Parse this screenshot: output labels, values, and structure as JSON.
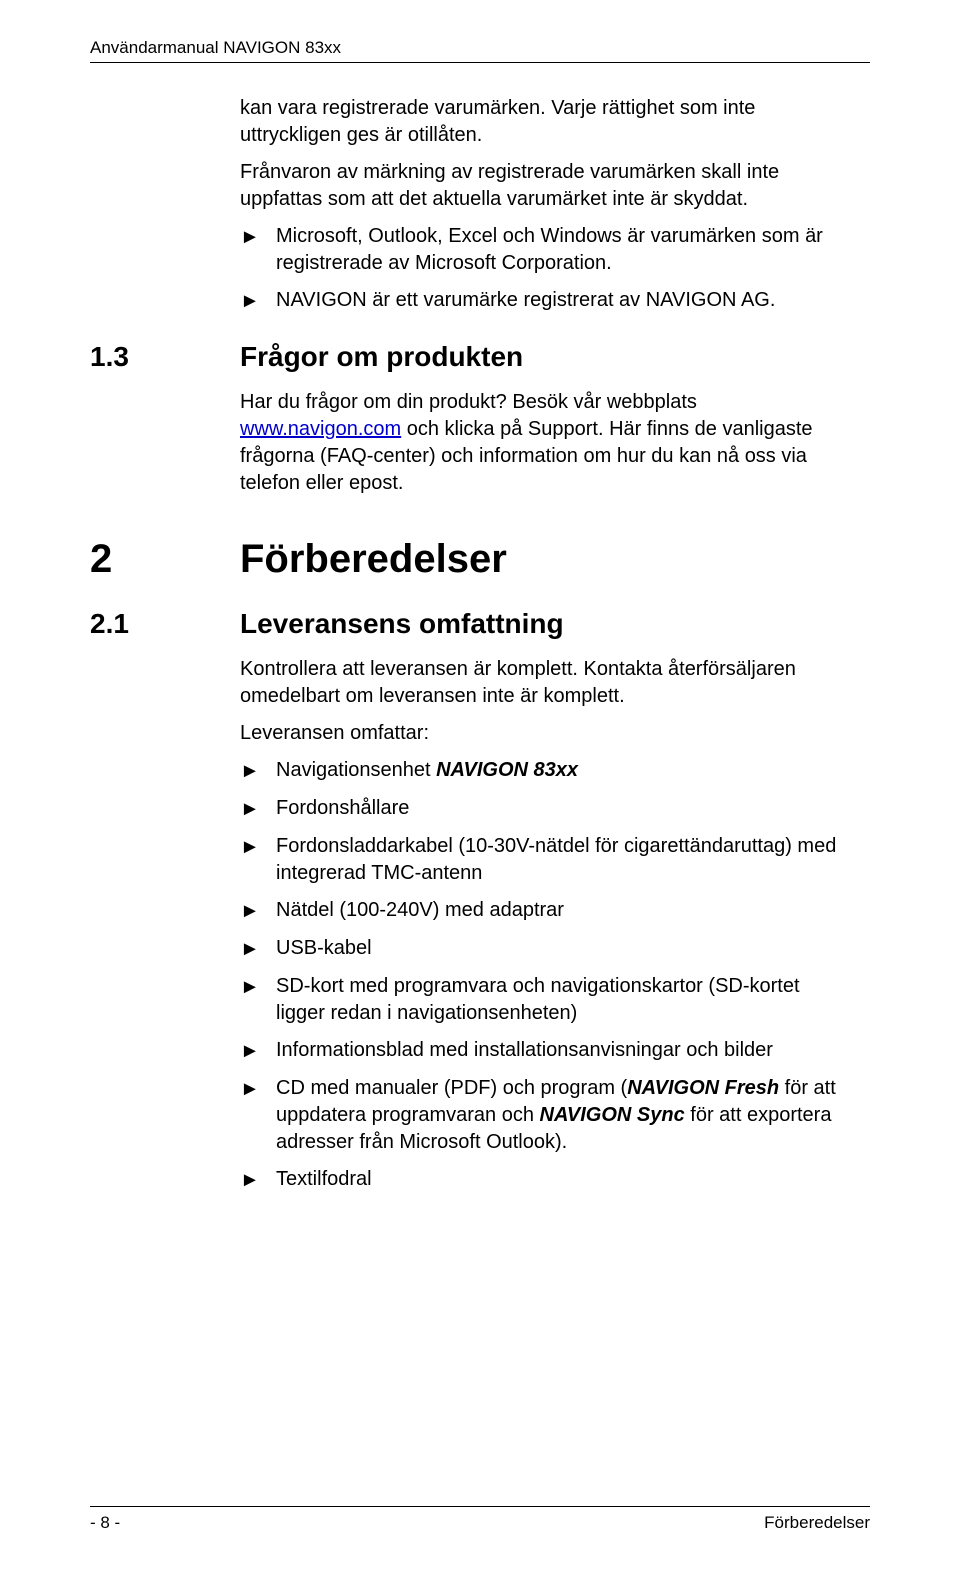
{
  "header": {
    "title": "Användarmanual NAVIGON 83xx"
  },
  "intro": {
    "p1": "kan vara registrerade varumärken. Varje rättighet som inte uttryckligen ges är otillåten.",
    "p2": "Frånvaron av märkning av registrerade varumärken skall inte uppfattas som att det aktuella varumärket inte är skyddat.",
    "bullets": [
      "Microsoft, Outlook, Excel och Windows är varumärken som är registrerade av Microsoft Corporation.",
      "NAVIGON är ett varumärke registrerat av NAVIGON AG."
    ]
  },
  "section13": {
    "num": "1.3",
    "title": "Frågor om produkten",
    "p1a": "Har du frågor om din produkt? Besök vår webbplats ",
    "link": "www.navigon.com",
    "p1b": " och klicka på Support. Här finns de vanligaste frågorna (FAQ-center) och information om hur du kan nå oss via telefon eller epost."
  },
  "chapter2": {
    "num": "2",
    "title": "Förberedelser"
  },
  "section21": {
    "num": "2.1",
    "title": "Leveransens omfattning",
    "p1": "Kontrollera att leveransen är komplett. Kontakta återförsäljaren omedelbart om leveransen inte är komplett.",
    "p2": "Leveransen omfattar:",
    "bullets": {
      "b1a": "Navigationsenhet ",
      "b1b": "NAVIGON 83xx",
      "b2": "Fordonshållare",
      "b3": "Fordonsladdarkabel (10-30V-nätdel för cigarettändaruttag) med integrerad TMC-antenn",
      "b4": "Nätdel (100-240V) med adaptrar",
      "b5": "USB-kabel",
      "b6": "SD-kort med programvara och navigationskartor (SD-kortet ligger redan i navigationsenheten)",
      "b7": "Informationsblad med installationsanvisningar och bilder",
      "b8a": "CD med manualer (PDF) och program (",
      "b8b": "NAVIGON Fresh",
      "b8c": " för att uppdatera programvaran och ",
      "b8d": "NAVIGON Sync",
      "b8e": " för att exportera adresser från Microsoft Outlook).",
      "b9": "Textilfodral"
    }
  },
  "footer": {
    "left": "- 8 -",
    "right": "Förberedelser"
  },
  "marker": "►"
}
